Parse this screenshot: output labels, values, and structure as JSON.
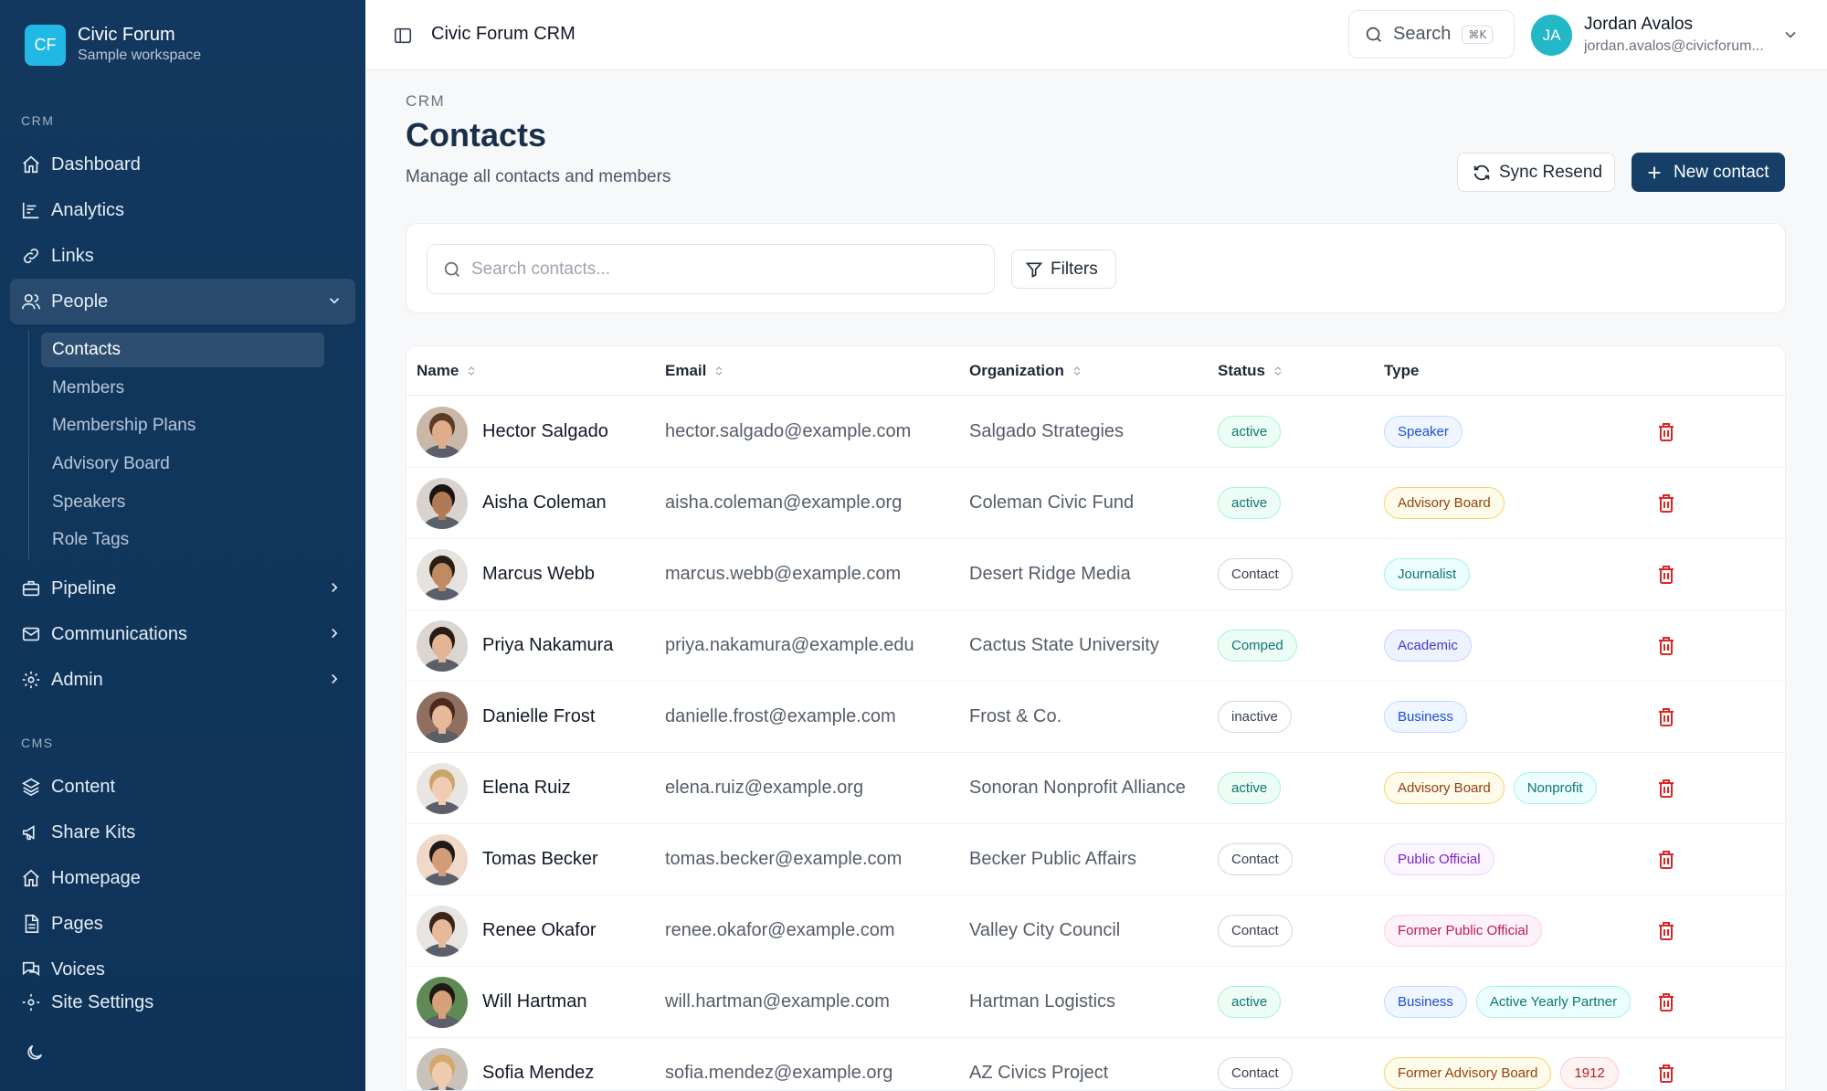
{
  "brand": {
    "initials": "CF",
    "name": "Civic Forum",
    "subtitle": "Sample workspace"
  },
  "sidebar": {
    "crm_label": "CRM",
    "crm_items": [
      {
        "label": "Dashboard",
        "icon": "home-icon"
      },
      {
        "label": "Analytics",
        "icon": "chart-icon"
      },
      {
        "label": "Links",
        "icon": "link-icon"
      },
      {
        "label": "People",
        "icon": "users-icon",
        "expanded": true
      }
    ],
    "people_sub": [
      "Contacts",
      "Members",
      "Membership Plans",
      "Advisory Board",
      "Speakers",
      "Role Tags"
    ],
    "more_items": [
      {
        "label": "Pipeline",
        "icon": "briefcase-icon"
      },
      {
        "label": "Communications",
        "icon": "mail-icon"
      },
      {
        "label": "Admin",
        "icon": "gear-icon"
      }
    ],
    "cms_label": "CMS",
    "cms_items": [
      {
        "label": "Content",
        "icon": "layers-icon"
      },
      {
        "label": "Share Kits",
        "icon": "megaphone-icon"
      },
      {
        "label": "Homepage",
        "icon": "home-icon"
      },
      {
        "label": "Pages",
        "icon": "document-icon"
      },
      {
        "label": "Voices",
        "icon": "chat-icon"
      },
      {
        "label": "Site Settings",
        "icon": "settings-icon"
      }
    ]
  },
  "topbar": {
    "title": "Civic Forum CRM",
    "search_label": "Search",
    "search_shortcut": "⌘K",
    "user": {
      "initials": "JA",
      "name": "Jordan Avalos",
      "email": "jordan.avalos@civicforum..."
    }
  },
  "header": {
    "breadcrumb": "CRM",
    "title": "Contacts",
    "subtitle": "Manage all contacts and members",
    "sync_label": "Sync Resend",
    "new_label": "New contact"
  },
  "filters": {
    "search_placeholder": "Search contacts...",
    "filters_label": "Filters"
  },
  "table": {
    "columns": [
      "Name",
      "Email",
      "Organization",
      "Status",
      "Type"
    ],
    "rows": [
      {
        "name": "Hector Salgado",
        "email": "hector.salgado@example.com",
        "org": "Salgado Strategies",
        "status": "active",
        "status_style": "green",
        "types": [
          {
            "label": "Speaker",
            "style": "blue"
          }
        ],
        "avatar": {
          "skin": "#e0ac8a",
          "hair": "#5b3a26",
          "bg": "#c9b8a8"
        }
      },
      {
        "name": "Aisha Coleman",
        "email": "aisha.coleman@example.org",
        "org": "Coleman Civic Fund",
        "status": "active",
        "status_style": "green",
        "types": [
          {
            "label": "Advisory Board",
            "style": "yellow"
          }
        ],
        "avatar": {
          "skin": "#b07a56",
          "hair": "#1c1410",
          "bg": "#d9d3cf"
        }
      },
      {
        "name": "Marcus Webb",
        "email": "marcus.webb@example.com",
        "org": "Desert Ridge Media",
        "status": "Contact",
        "status_style": "gray",
        "types": [
          {
            "label": "Journalist",
            "style": "teal"
          }
        ],
        "avatar": {
          "skin": "#c08a62",
          "hair": "#2a1d14",
          "bg": "#e6e2de"
        }
      },
      {
        "name": "Priya Nakamura",
        "email": "priya.nakamura@example.edu",
        "org": "Cactus State University",
        "status": "Comped",
        "status_style": "green",
        "types": [
          {
            "label": "Academic",
            "style": "indigo"
          }
        ],
        "avatar": {
          "skin": "#e3b596",
          "hair": "#2b1a12",
          "bg": "#dcd6d2"
        }
      },
      {
        "name": "Danielle Frost",
        "email": "danielle.frost@example.com",
        "org": "Frost & Co.",
        "status": "inactive",
        "status_style": "gray",
        "types": [
          {
            "label": "Business",
            "style": "blue"
          }
        ],
        "avatar": {
          "skin": "#e8b89a",
          "hair": "#4a2a1c",
          "bg": "#8f6f5f"
        }
      },
      {
        "name": "Elena Ruiz",
        "email": "elena.ruiz@example.org",
        "org": "Sonoran Nonprofit Alliance",
        "status": "active",
        "status_style": "green",
        "types": [
          {
            "label": "Advisory Board",
            "style": "yellow"
          },
          {
            "label": "Nonprofit",
            "style": "teal"
          }
        ],
        "avatar": {
          "skin": "#f0cdb2",
          "hair": "#c9a56a",
          "bg": "#e9e6e2"
        }
      },
      {
        "name": "Tomas Becker",
        "email": "tomas.becker@example.com",
        "org": "Becker Public Affairs",
        "status": "Contact",
        "status_style": "gray",
        "types": [
          {
            "label": "Public Official",
            "style": "purple"
          }
        ],
        "avatar": {
          "skin": "#d29c78",
          "hair": "#1f1a18",
          "bg": "#f0d9c8"
        }
      },
      {
        "name": "Renee Okafor",
        "email": "renee.okafor@example.com",
        "org": "Valley City Council",
        "status": "Contact",
        "status_style": "gray",
        "types": [
          {
            "label": "Former Public Official",
            "style": "pink"
          }
        ],
        "avatar": {
          "skin": "#e6b999",
          "hair": "#3d2418",
          "bg": "#e8e4e1"
        }
      },
      {
        "name": "Will Hartman",
        "email": "will.hartman@example.com",
        "org": "Hartman Logistics",
        "status": "active",
        "status_style": "green",
        "types": [
          {
            "label": "Business",
            "style": "blue"
          },
          {
            "label": "Active Yearly Partner",
            "style": "teal"
          }
        ],
        "avatar": {
          "skin": "#d5a07a",
          "hair": "#1e1a16",
          "bg": "#5f8a55"
        }
      },
      {
        "name": "Sofia Mendez",
        "email": "sofia.mendez@example.org",
        "org": "AZ Civics Project",
        "status": "Contact",
        "status_style": "gray",
        "types": [
          {
            "label": "Former Advisory Board",
            "style": "yellow"
          },
          {
            "label": "1912",
            "style": "red"
          }
        ],
        "avatar": {
          "skin": "#f0cbb0",
          "hair": "#d4a868",
          "bg": "#c9c2ba"
        }
      }
    ]
  }
}
